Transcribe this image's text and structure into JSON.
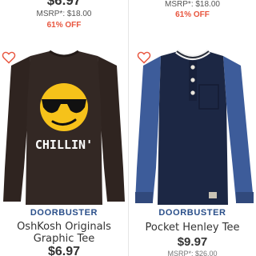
{
  "products": [
    {
      "top_price": "$6.97",
      "msrp": "MSRP*: $18.00",
      "discount": "61% OFF",
      "badge": "DOORBUSTER",
      "name_line1": "OshKosh Originals",
      "name_line2": "Graphic Tee",
      "price": "$6.97",
      "graphic_text": "CHILLIN'",
      "shirt_color": "#2f2420"
    },
    {
      "top_price": "",
      "msrp": "MSRP*: $18.00",
      "discount": "61% OFF",
      "badge": "DOORBUSTER",
      "name": "Pocket Henley Tee",
      "price": "$9.97",
      "msrp_bottom": "MSRP*: $26.00",
      "body_color": "#1c2744",
      "sleeve_color": "#3d5c9a"
    }
  ],
  "colors": {
    "accent_red": "#e8553e",
    "badge_blue": "#2a4f8a",
    "heart": "#e8553e"
  }
}
